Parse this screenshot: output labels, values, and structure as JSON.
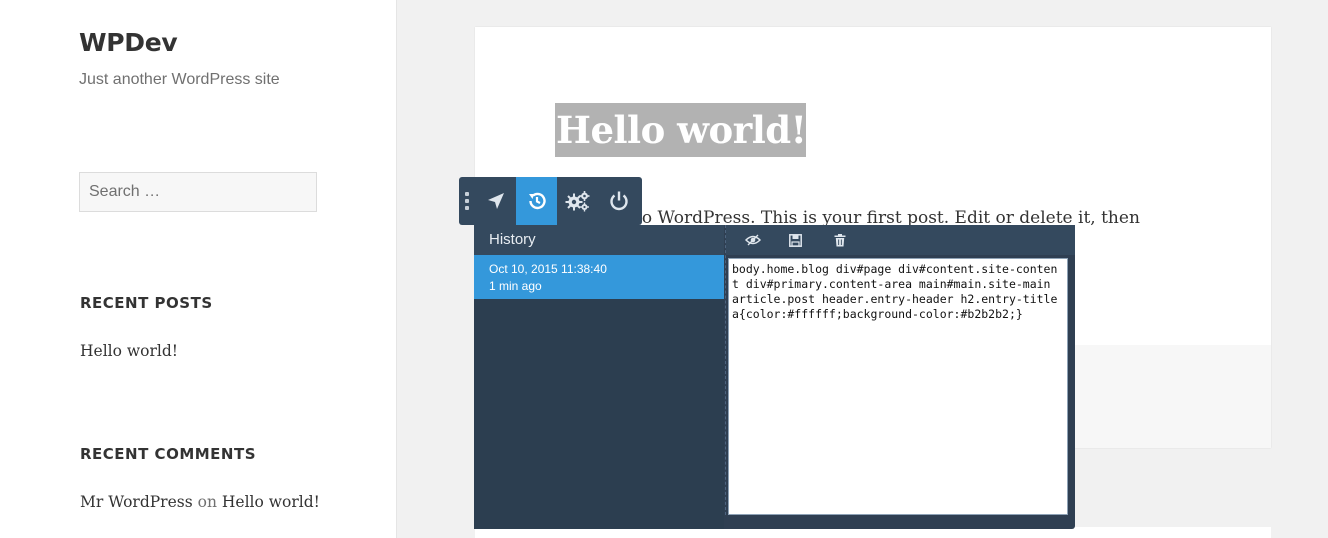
{
  "site": {
    "title": "WPDev",
    "description": "Just another WordPress site"
  },
  "search": {
    "placeholder": "Search …"
  },
  "widgets": {
    "recent_posts_title": "RECENT POSTS",
    "recent_post": "Hello world!",
    "recent_comments_title": "RECENT COMMENTS",
    "comment_author": "Mr WordPress",
    "comment_on": "on",
    "comment_post": "Hello world!"
  },
  "post": {
    "title": "Hello world!",
    "excerpt": "to WordPress. This is your first post. Edit or delete it, then"
  },
  "toolbar": {
    "buttons": [
      {
        "icon": "navigate-arrow-icon",
        "active": false
      },
      {
        "icon": "history-icon",
        "active": true
      },
      {
        "icon": "settings-gears-icon",
        "active": false
      },
      {
        "icon": "power-icon",
        "active": false
      }
    ]
  },
  "history": {
    "header": "History",
    "items": [
      {
        "date": "Oct 10, 2015 11:38:40",
        "ago": "1 min ago"
      }
    ],
    "actions": [
      "preview-eye-icon",
      "save-icon",
      "delete-trash-icon"
    ],
    "code": "body.home.blog div#page div#content.site-content div#primary.content-area main#main.site-main article.post header.entry-header h2.entry-title a{color:#ffffff;background-color:#b2b2b2;}"
  },
  "colors": {
    "accent": "#3498db",
    "panel_bg": "#2c3e50",
    "toolbar_bg": "#34495e",
    "highlight_bg": "#b2b2b2"
  }
}
